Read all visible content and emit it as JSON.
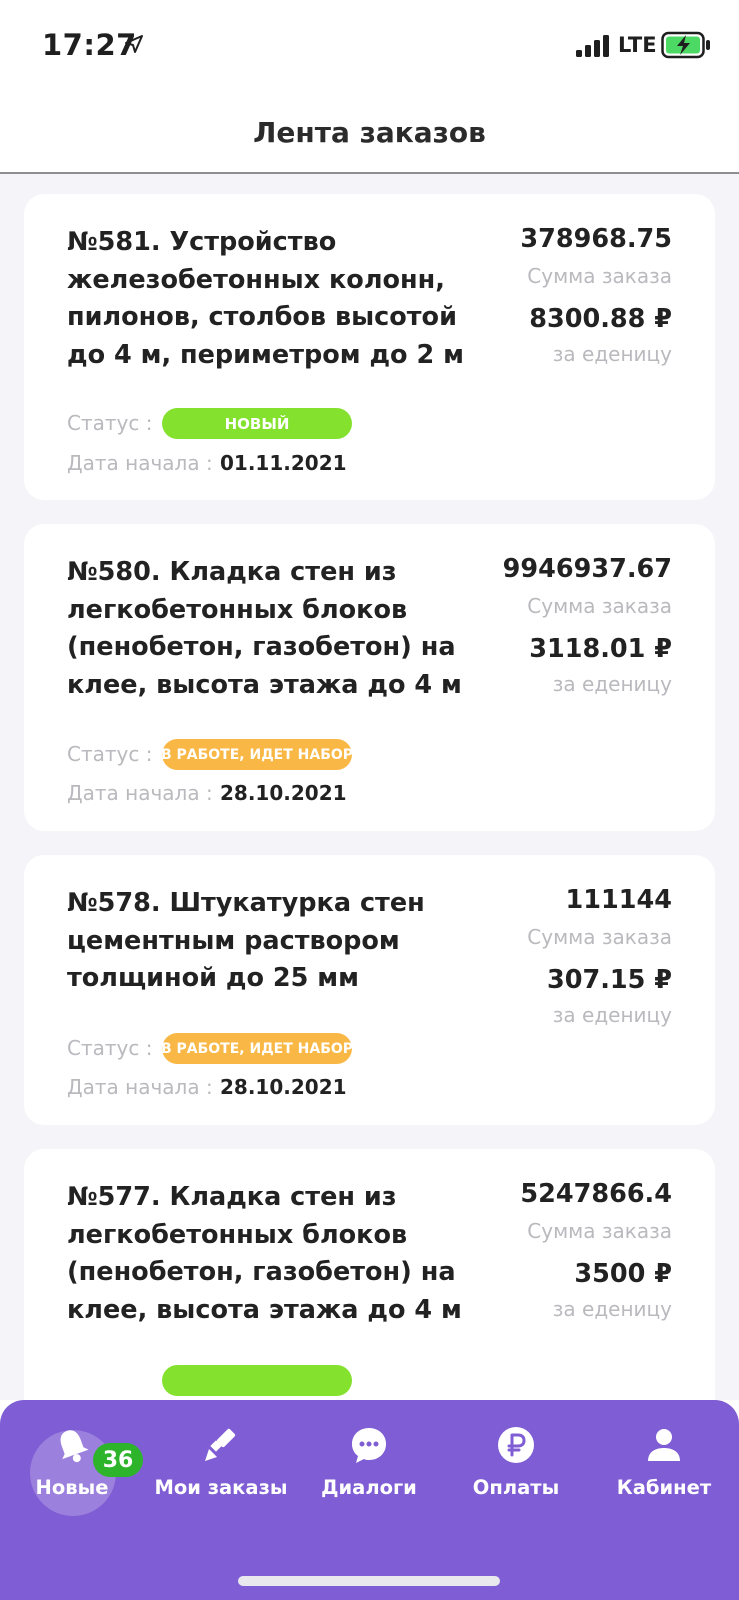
{
  "status_bar": {
    "time": "17:27",
    "network": "LTE",
    "icons": [
      "location-arrow-icon",
      "signal-icon",
      "battery-charging-icon"
    ]
  },
  "header": {
    "title": "Лента заказов"
  },
  "orders": [
    {
      "title": "№581. Устройство железобетонных колонн, пилонов, столбов высотой до 4 м, периметром до 2 м",
      "total": "378968.75",
      "total_label": "Сумма заказа",
      "unit_price": "8300.88 ₽",
      "unit_label": "за еденицу",
      "status_label": "Статус :",
      "status": "НОВЫЙ",
      "status_color": "#84e22e",
      "date_label": "Дата начала :",
      "date": "01.11.2021"
    },
    {
      "title": "№580. Кладка стен из легкобетонных блоков (пенобетон, газобетон) на клее, высота этажа до 4 м",
      "total": "9946937.67",
      "total_label": "Сумма заказа",
      "unit_price": "3118.01 ₽",
      "unit_label": "за еденицу",
      "status_label": "Статус :",
      "status": "В РАБОТЕ, ИДЕТ НАБОР",
      "status_color": "#f9b846",
      "date_label": "Дата начала :",
      "date": "28.10.2021"
    },
    {
      "title": "№578. Штукатурка стен цементным раствором толщиной до 25 мм",
      "total": "111144",
      "total_label": "Сумма заказа",
      "unit_price": "307.15 ₽",
      "unit_label": "за еденицу",
      "status_label": "Статус :",
      "status": "В РАБОТЕ, ИДЕТ НАБОР",
      "status_color": "#f9b846",
      "date_label": "Дата начала :",
      "date": "28.10.2021"
    },
    {
      "title": "№577. Кладка стен из легкобетонных блоков (пенобетон, газобетон) на клее, высота этажа до 4 м",
      "total": "5247866.4",
      "total_label": "Сумма заказа",
      "unit_price": "3500 ₽",
      "unit_label": "за еденицу"
    }
  ],
  "tab_bar": {
    "background": "#7f5dd4",
    "tabs": [
      {
        "label": "Новые",
        "icon": "bell-icon",
        "badge": "36",
        "active": true
      },
      {
        "label": "Мои заказы",
        "icon": "paint-brush-icon"
      },
      {
        "label": "Диалоги",
        "icon": "chat-bubble-icon"
      },
      {
        "label": "Оплаты",
        "icon": "ruble-coin-icon"
      },
      {
        "label": "Кабинет",
        "icon": "user-icon"
      }
    ]
  }
}
